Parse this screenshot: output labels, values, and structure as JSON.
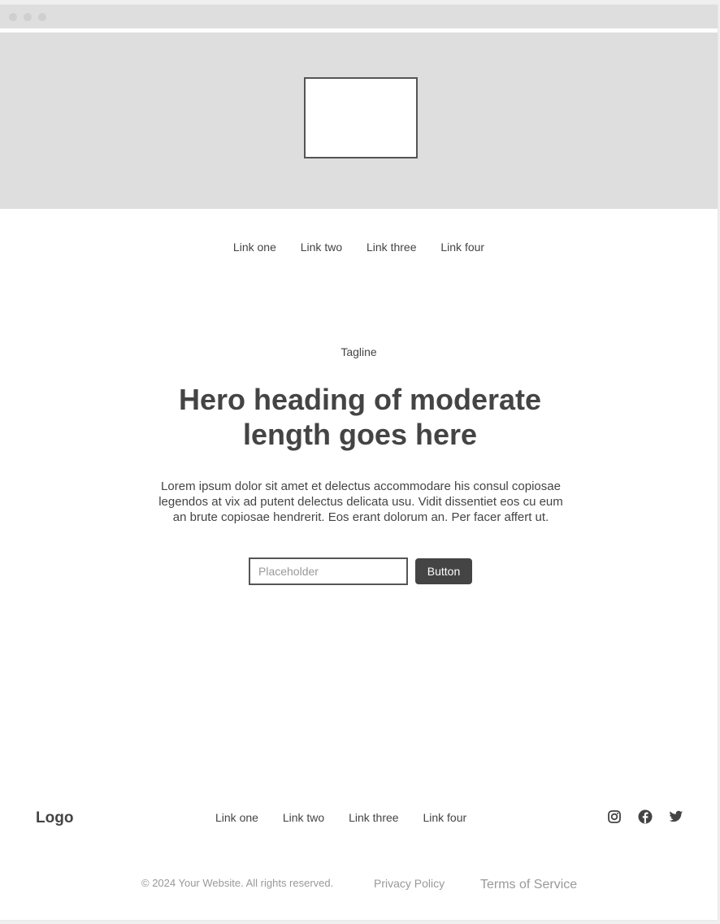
{
  "header": {
    "nav": [
      "Link one",
      "Link two",
      "Link three",
      "Link four"
    ]
  },
  "hero": {
    "tagline": "Tagline",
    "title_line1": "Hero heading of moderate",
    "title_line2": "length goes here",
    "text": "Lorem ipsum dolor sit amet et delectus accommodare his consul copiosae legendos at vix ad putent delectus delicata usu. Vidit dissentiet eos cu eum an brute copiosae hendrerit. Eos erant dolorum an. Per facer affert ut.",
    "input_placeholder": "Placeholder",
    "button_label": "Button"
  },
  "footer": {
    "logo": "Logo",
    "nav": [
      "Link one",
      "Link two",
      "Link three",
      "Link four"
    ],
    "social_icons": [
      "instagram-icon",
      "facebook-icon",
      "twitter-icon"
    ],
    "copyright": "© 2024 Your Website. All rights reserved.",
    "privacy": "Privacy Policy",
    "terms": "Terms of Service"
  },
  "colors": {
    "banner": "#dedede",
    "text": "#444444",
    "button": "#444444",
    "muted": "#999999"
  }
}
